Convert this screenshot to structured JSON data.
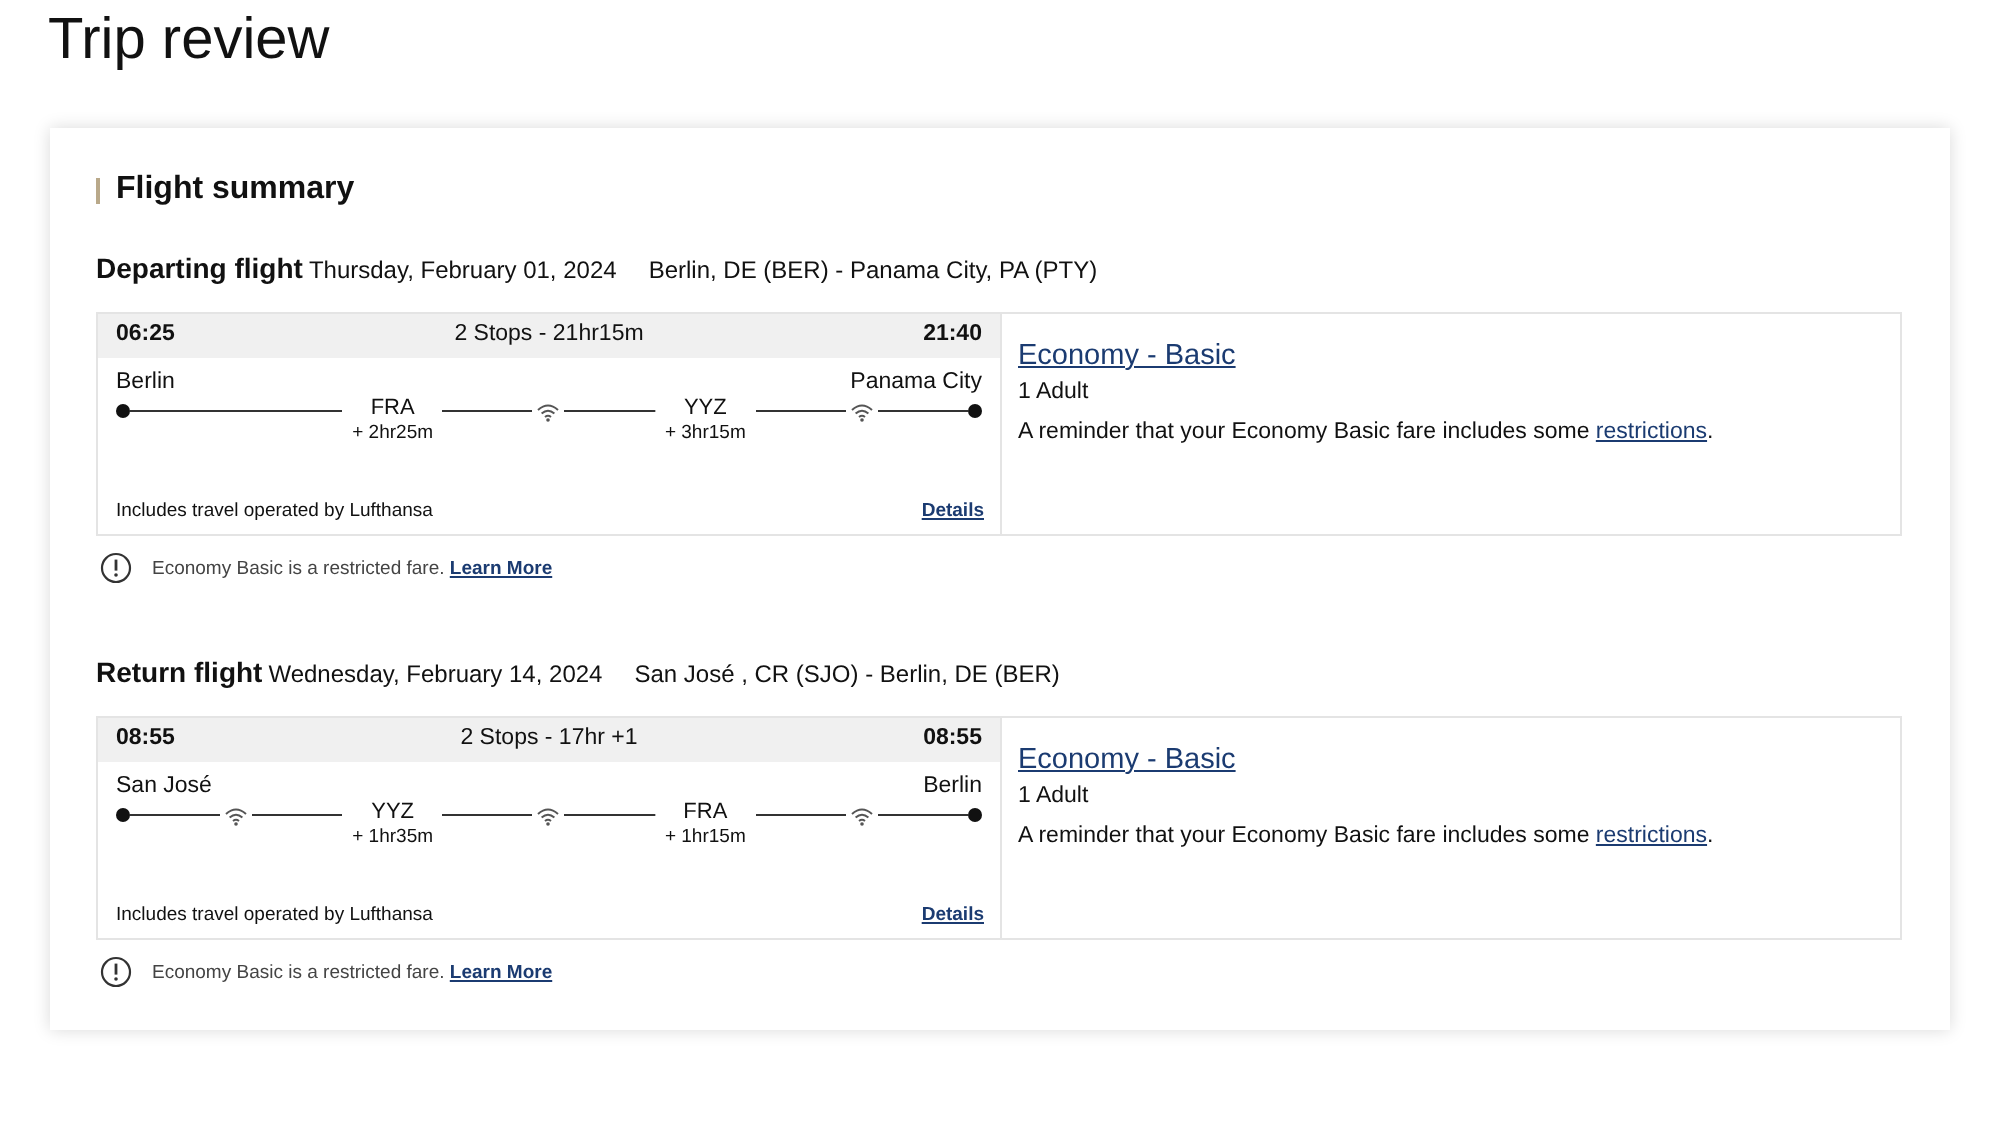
{
  "page_title": "Trip review",
  "summary": {
    "heading": "Flight summary",
    "flights": [
      {
        "label": "Departing flight",
        "date": "Thursday, February 01, 2024",
        "route": "Berlin, DE (BER) - Panama City, PA (PTY)",
        "depart_time": "06:25",
        "stops_summary": "2 Stops - 21hr15m",
        "arrive_time": "21:40",
        "origin": "Berlin",
        "destination": "Panama City",
        "segments": [
          {
            "wifi": false
          },
          {
            "wifi": true
          },
          {
            "wifi": true
          }
        ],
        "stops": [
          {
            "code": "FRA",
            "layover": "+ 2hr25m"
          },
          {
            "code": "YYZ",
            "layover": "+ 3hr15m"
          }
        ],
        "operator_note": "Includes travel operated by Lufthansa",
        "details_link": "Details",
        "fare": {
          "name": "Economy - Basic",
          "passengers": "1 Adult",
          "reminder": "A reminder that your Economy Basic fare includes some ",
          "reminder_link": "restrictions",
          "reminder_end": "."
        },
        "notice": {
          "text": "Economy Basic is a restricted fare.",
          "link": "Learn More"
        }
      },
      {
        "label": "Return flight",
        "date": "Wednesday, February 14, 2024",
        "route": "San José , CR (SJO) - Berlin, DE (BER)",
        "depart_time": "08:55",
        "stops_summary": "2 Stops - 17hr +1",
        "arrive_time": "08:55",
        "origin": "San José",
        "destination": "Berlin",
        "segments": [
          {
            "wifi": true
          },
          {
            "wifi": true
          },
          {
            "wifi": true
          }
        ],
        "stops": [
          {
            "code": "YYZ",
            "layover": "+ 1hr35m"
          },
          {
            "code": "FRA",
            "layover": "+ 1hr15m"
          }
        ],
        "operator_note": "Includes travel operated by Lufthansa",
        "details_link": "Details",
        "fare": {
          "name": "Economy - Basic",
          "passengers": "1 Adult",
          "reminder": "A reminder that your Economy Basic fare includes some ",
          "reminder_link": "restrictions",
          "reminder_end": "."
        },
        "notice": {
          "text": "Economy Basic is a restricted fare.",
          "link": "Learn More"
        }
      }
    ]
  }
}
